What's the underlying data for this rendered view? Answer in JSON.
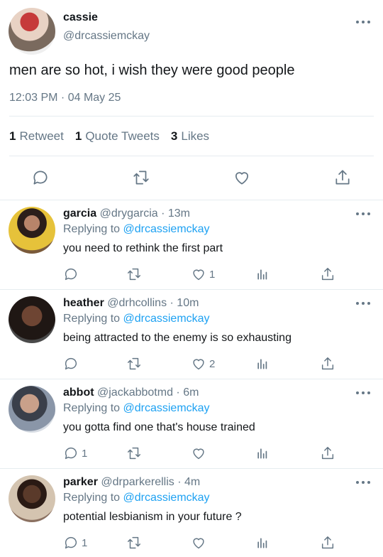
{
  "main_tweet": {
    "name": "cassie",
    "handle": "@drcassiemckay",
    "text": "men are so hot, i wish they were good people",
    "timestamp": "12:03 PM · 04 May 25",
    "stats": {
      "retweets_count": "1",
      "retweets_label": "Retweet",
      "quotes_count": "1",
      "quotes_label": "Quote Tweets",
      "likes_count": "3",
      "likes_label": "Likes"
    }
  },
  "replies": [
    {
      "name": "garcia",
      "handle": "@drygarcia",
      "time": "· 13m",
      "replying_label": "Replying to",
      "replying_to": "@drcassiemckay",
      "text": "you need to rethink the first part",
      "reply_count": "",
      "like_count": "1"
    },
    {
      "name": "heather",
      "handle": "@drhcollins",
      "time": "· 10m",
      "replying_label": "Replying to",
      "replying_to": "@drcassiemckay",
      "text": "being attracted to the enemy is so exhausting",
      "reply_count": "",
      "like_count": "2"
    },
    {
      "name": "abbot",
      "handle": "@jackabbotmd",
      "time": "· 6m",
      "replying_label": "Replying to",
      "replying_to": "@drcassiemckay",
      "text": "you gotta find one that's house trained",
      "reply_count": "1",
      "like_count": ""
    },
    {
      "name": "parker",
      "handle": "@drparkerellis",
      "time": "· 4m",
      "replying_label": "Replying to",
      "replying_to": "@drcassiemckay",
      "text": "potential lesbianism in your future ?",
      "reply_count": "1",
      "like_count": ""
    }
  ],
  "icons": {
    "reply": "reply-icon",
    "retweet": "retweet-icon",
    "like": "heart-icon",
    "analytics": "analytics-icon",
    "share": "share-icon",
    "more": "more-icon"
  },
  "colors": {
    "accent": "#1da1f2",
    "secondary": "#657786",
    "border": "#e6ecf0"
  }
}
